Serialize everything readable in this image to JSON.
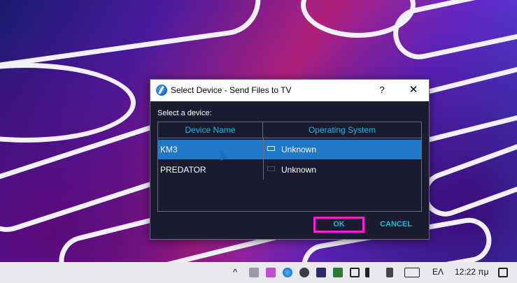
{
  "dialog": {
    "title": "Select Device - Send Files to TV",
    "help_label": "?",
    "close_label": "✕",
    "prompt": "Select a device:",
    "columns": [
      "Device Name",
      "Operating System"
    ],
    "rows": [
      {
        "name": "KM3",
        "os": "Unknown",
        "selected": true
      },
      {
        "name": "PREDATOR",
        "os": "Unknown",
        "selected": false
      }
    ],
    "ok_label": "OK",
    "cancel_label": "CANCEL"
  },
  "taskbar": {
    "chevron": "^",
    "language": "ΕΛ",
    "time": "12:22 πμ"
  }
}
